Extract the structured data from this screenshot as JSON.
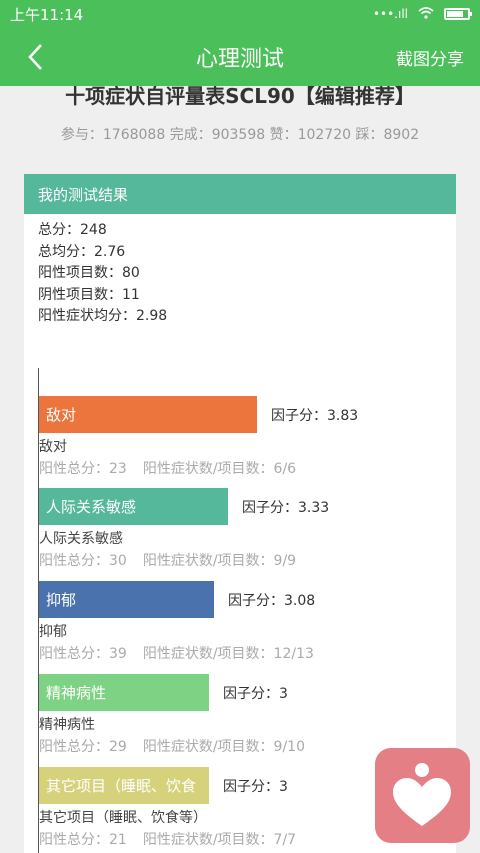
{
  "status": {
    "time": "上午11:14"
  },
  "app_bar": {
    "title": "心理测试",
    "share_label": "截图分享"
  },
  "test": {
    "title": "十项症状自评量表SCL90【编辑推荐】",
    "stats": "参与：1768088 完成：903598 赞：102720 踩：8902"
  },
  "result": {
    "header": "我的测试结果",
    "summary": [
      "总分：248",
      "总均分：2.76",
      "阳性项目数：80",
      "阴性项目数：11",
      "阳性症状均分：2.98"
    ]
  },
  "factors": [
    {
      "name": "敌对",
      "bar_label": "敌对",
      "score_text": "因子分：3.83",
      "score": 3.83,
      "positive_total": "阳性总分：23",
      "positive_ratio": "阳性症状数/项目数：6/6",
      "color": "#ec743d"
    },
    {
      "name": "人际关系敏感",
      "bar_label": "人际关系敏感",
      "score_text": "因子分：3.33",
      "score": 3.33,
      "positive_total": "阳性总分：30",
      "positive_ratio": "阳性症状数/项目数：9/9",
      "color": "#56b89a"
    },
    {
      "name": "抑郁",
      "bar_label": "抑郁",
      "score_text": "因子分：3.08",
      "score": 3.08,
      "positive_total": "阳性总分：39",
      "positive_ratio": "阳性症状数/项目数：12/13",
      "color": "#4a72ad"
    },
    {
      "name": "精神病性",
      "bar_label": "精神病性",
      "score_text": "因子分：3",
      "score": 3,
      "positive_total": "阳性总分：29",
      "positive_ratio": "阳性症状数/项目数：9/10",
      "color": "#7dd283"
    },
    {
      "name": "其它项目（睡眠、饮食等）",
      "bar_label": "其它项目（睡眠、饮食",
      "score_text": "因子分：3",
      "score": 3,
      "positive_total": "阳性总分：21",
      "positive_ratio": "阳性症状数/项目数：7/7",
      "color": "#d6d27c"
    }
  ]
}
